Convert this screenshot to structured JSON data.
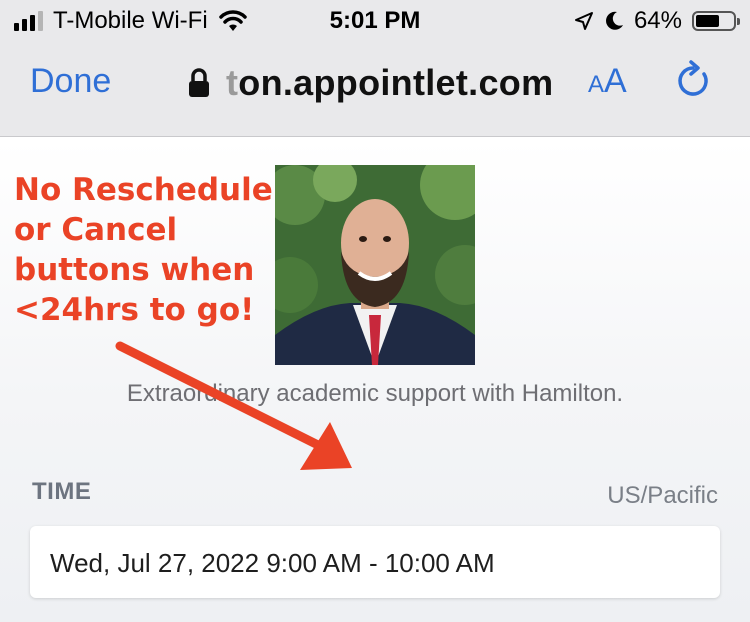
{
  "status_bar": {
    "carrier": "T-Mobile Wi-Fi",
    "time": "5:01 PM",
    "battery_percent": "64%",
    "battery_level": 0.64,
    "icons": [
      "signal-icon",
      "wifi-icon",
      "location-arrow-icon",
      "moon-icon",
      "battery-icon"
    ]
  },
  "browser": {
    "done_label": "Done",
    "url_faded": "t",
    "url": "on.appointlet.com",
    "text_size_small": "A",
    "text_size_large": "A",
    "icons": [
      "lock-icon",
      "text-size-icon",
      "reload-icon"
    ],
    "accent_color": "#2f6fd6"
  },
  "annotation": {
    "lines": [
      "No Reschedule",
      "or Cancel",
      "buttons when",
      "<24hrs to go!"
    ],
    "color": "#ea4326"
  },
  "page": {
    "subtitle": "Extraordinary academic support with Hamilton.",
    "time_label": "TIME",
    "timezone": "US/Pacific",
    "time_value": "Wed, Jul 27, 2022 9:00 AM - 10:00 AM"
  }
}
